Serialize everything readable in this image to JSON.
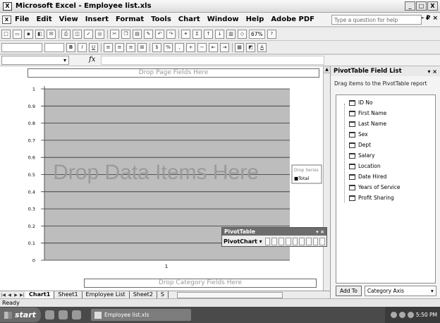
{
  "window": {
    "title": "Microsoft Excel - Employee list.xls",
    "app_icon": "excel-icon",
    "controls": [
      "_",
      "□",
      "X"
    ]
  },
  "menu": {
    "items": [
      "File",
      "Edit",
      "View",
      "Insert",
      "Format",
      "Tools",
      "Chart",
      "Window",
      "Help",
      "Adobe PDF"
    ],
    "ask_placeholder": "Type a question for help",
    "doc_controls": "- ₽ ×"
  },
  "toolbar1": {
    "zoom": "67%"
  },
  "formula_bar": {
    "fx": "fx"
  },
  "chart": {
    "drop_page": "Drop Page Fields Here",
    "drop_data": "Drop Data Items Here",
    "drop_category": "Drop Category Fields Here",
    "legend": [
      "Drop Series",
      "■Total"
    ],
    "x_tick": "1"
  },
  "chart_data": {
    "type": "bar",
    "title": "",
    "categories": [
      "1"
    ],
    "series": [
      {
        "name": "Total",
        "values": [
          1
        ]
      }
    ],
    "y_ticks": [
      "1",
      "0.9",
      "0.8",
      "0.7",
      "0.6",
      "0.5",
      "0.4",
      "0.3",
      "0.2",
      "0.1",
      "0"
    ],
    "ylim": [
      0,
      1
    ],
    "grid": true,
    "legend_position": "right"
  },
  "sheets": {
    "tabs": [
      "Chart1",
      "Sheet1",
      "Employee List",
      "Sheet2",
      "S"
    ],
    "active": "Chart1"
  },
  "status": {
    "text": "Ready"
  },
  "pivot_pane": {
    "title": "PivotTable Field List",
    "description": "Drag items to the PivotTable report",
    "fields": [
      "ID No",
      "First Name",
      "Last Name",
      "Sex",
      "Dept",
      "Salary",
      "Location",
      "Date Hired",
      "Years of Service",
      "Profit Sharing"
    ],
    "add_button": "Add To",
    "area_value": "Category Axis"
  },
  "pivot_toolbar": {
    "title": "PivotTable",
    "button": "PivotChart ▾"
  },
  "taskbar": {
    "start": "start",
    "task": "Employee list.xls",
    "clock": "5:50 PM"
  }
}
